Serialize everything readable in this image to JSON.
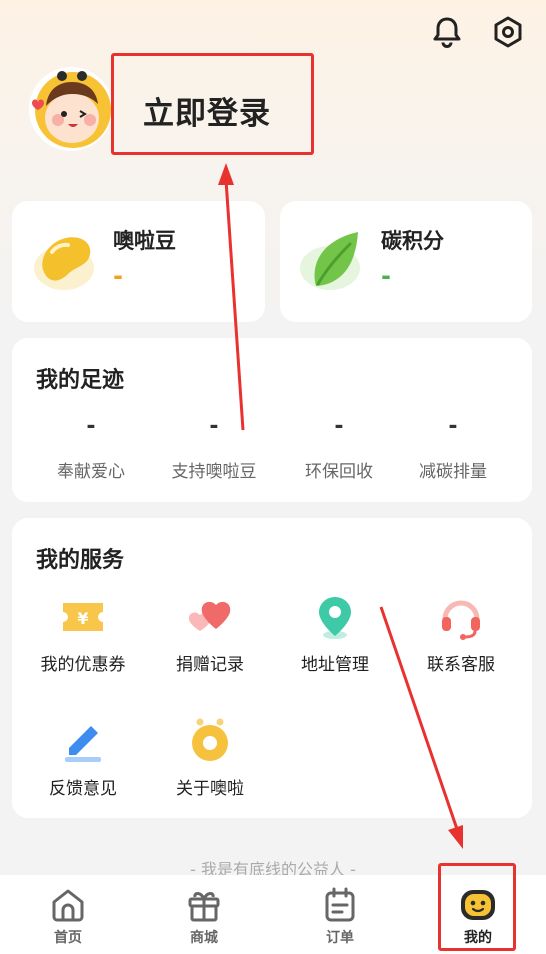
{
  "header": {
    "icons": [
      "bell-icon",
      "settings-hex-icon"
    ],
    "login_label": "立即登录"
  },
  "assets": {
    "beans": {
      "title": "噢啦豆",
      "value": "-",
      "value_color": "#f0a21e"
    },
    "carbon": {
      "title": "碳积分",
      "value": "-",
      "value_color": "#4cb34c"
    }
  },
  "footprint": {
    "title": "我的足迹",
    "stats": [
      {
        "value": "-",
        "label": "奉献爱心"
      },
      {
        "value": "-",
        "label": "支持噢啦豆"
      },
      {
        "value": "-",
        "label": "环保回收"
      },
      {
        "value": "-",
        "label": "减碳排量"
      }
    ]
  },
  "services": {
    "title": "我的服务",
    "items": [
      {
        "label": "我的优惠券",
        "icon": "coupon-icon"
      },
      {
        "label": "捐赠记录",
        "icon": "hearts-icon"
      },
      {
        "label": "地址管理",
        "icon": "location-pin-icon"
      },
      {
        "label": "联系客服",
        "icon": "headset-icon"
      },
      {
        "label": "反馈意见",
        "icon": "pen-icon"
      },
      {
        "label": "关于噢啦",
        "icon": "about-ring-icon"
      }
    ]
  },
  "footer_note": "- 我是有底线的公益人 -",
  "tabs": [
    {
      "label": "首页",
      "icon": "home-icon"
    },
    {
      "label": "商城",
      "icon": "gift-icon"
    },
    {
      "label": "订单",
      "icon": "order-icon"
    },
    {
      "label": "我的",
      "icon": "mine-face-icon",
      "active": true
    }
  ],
  "colors": {
    "accent_red": "#e8322f",
    "bean_yellow": "#f5c53b",
    "leaf_green": "#6cc24a",
    "map_teal": "#3ec9a7",
    "pen_blue": "#3f8cf0"
  }
}
